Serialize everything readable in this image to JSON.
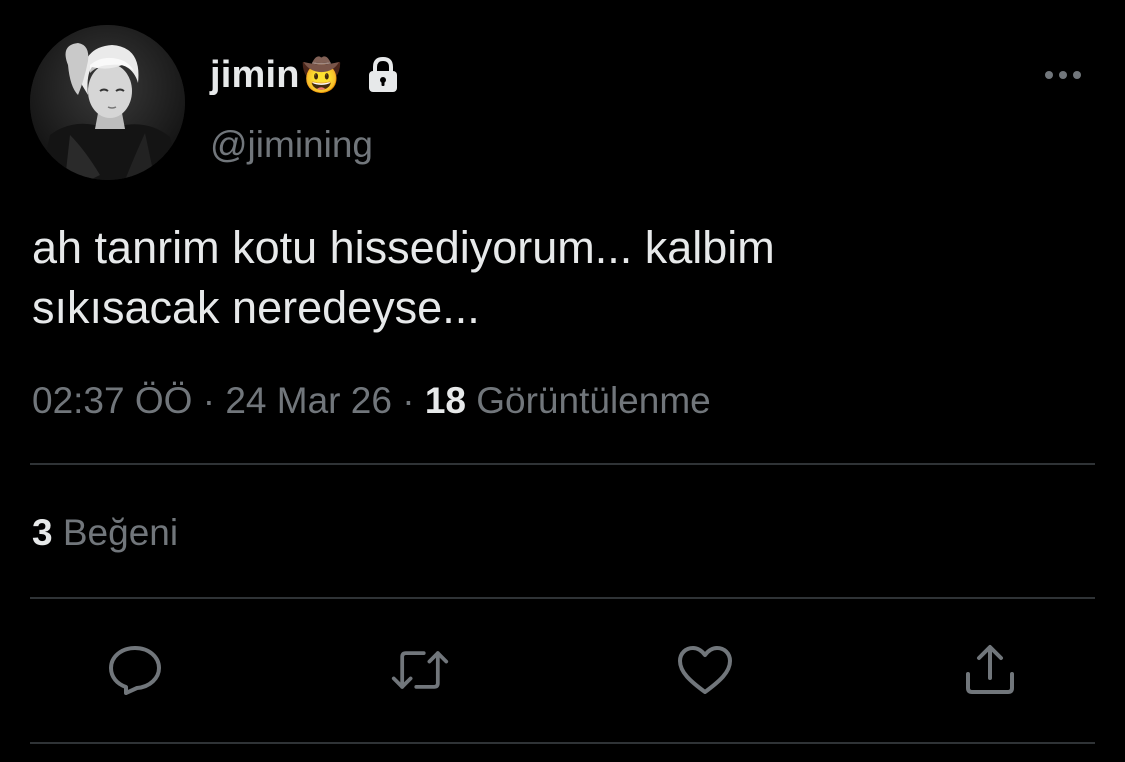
{
  "author": {
    "display_name": "jimin",
    "emoji": "🤠",
    "handle": "@jimining",
    "avatar_icon": "profile-photo",
    "locked_icon": "lock-icon"
  },
  "tweet": {
    "text_line1": "ah tanrim kotu hissediyorum... kalbim",
    "text_line2": "sıkısacak neredeyse..."
  },
  "meta": {
    "time": "02:37 ÖÖ",
    "separator": "·",
    "date": "24 Mar 26",
    "views_count": "18",
    "views_label": "Görüntülenme"
  },
  "stats": {
    "likes_count": "3",
    "likes_label": "Beğeni"
  },
  "actions": {
    "reply_icon": "reply-icon",
    "retweet_icon": "retweet-icon",
    "like_icon": "heart-icon",
    "share_icon": "share-icon"
  },
  "colors": {
    "background": "#000000",
    "primary_text": "#e7e9ea",
    "secondary_text": "#71767b",
    "divider": "#2f3336"
  }
}
